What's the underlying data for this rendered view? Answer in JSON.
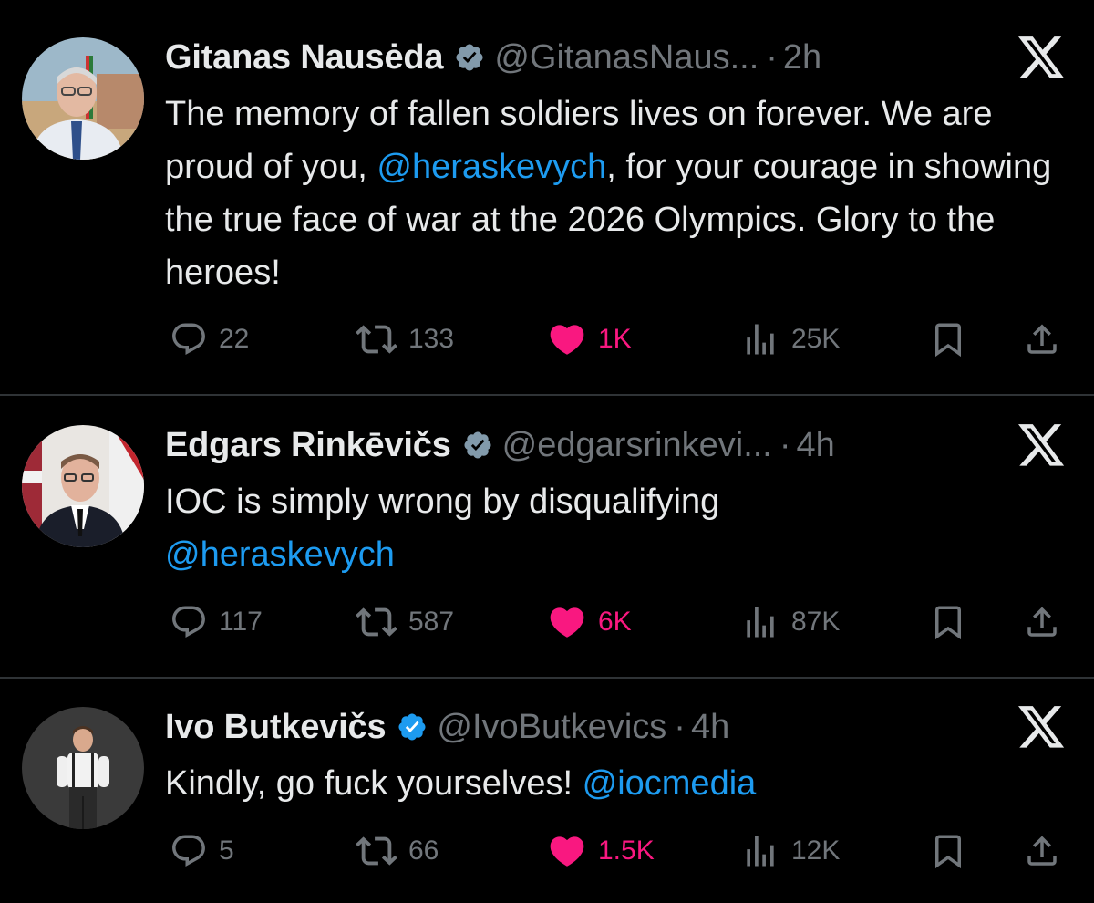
{
  "tweets": [
    {
      "name": "Gitanas Nausėda",
      "handle": "@GitanasNaus...",
      "dot": "·",
      "time": "2h",
      "verified_color": "#829aab",
      "text_parts": [
        {
          "text": "The memory of fallen soldiers lives on forever. We are proud of you, ",
          "mention": false
        },
        {
          "text": "@heraskevych",
          "mention": true
        },
        {
          "text": ", for your courage in showing the true face of war at the 2026 Olympics. Glory to the heroes!",
          "mention": false
        }
      ],
      "replies": "22",
      "reposts": "133",
      "likes": "1K",
      "views": "25K"
    },
    {
      "name": "Edgars Rinkēvičs",
      "handle": "@edgarsrinkevi...",
      "dot": "·",
      "time": "4h",
      "verified_color": "#829aab",
      "text_parts": [
        {
          "text": "IOC is simply wrong by disqualifying ",
          "mention": false
        },
        {
          "text": "@heraskevych",
          "mention": true
        }
      ],
      "replies": "117",
      "reposts": "587",
      "likes": "6K",
      "views": "87K"
    },
    {
      "name": "Ivo Butkevičs",
      "handle": "@IvoButkevics",
      "dot": "·",
      "time": "4h",
      "verified_color": "#1d9bf0",
      "text_parts": [
        {
          "text": "Kindly, go fuck yourselves! ",
          "mention": false
        },
        {
          "text": "@iocmedia",
          "mention": true
        }
      ],
      "replies": "5",
      "reposts": "66",
      "likes": "1.5K",
      "views": "12K"
    }
  ],
  "icons": {
    "reply": "reply-icon",
    "repost": "repost-icon",
    "like": "heart-icon",
    "views": "views-icon",
    "bookmark": "bookmark-icon",
    "share": "share-icon",
    "x_logo": "x-logo-icon",
    "verified": "verified-badge-icon"
  },
  "colors": {
    "background": "#000000",
    "text": "#e7e9ea",
    "secondary": "#71767b",
    "mention": "#1d9bf0",
    "like": "#f91880",
    "divider": "#2f3336"
  }
}
